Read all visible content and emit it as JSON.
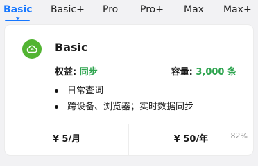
{
  "tabs": [
    {
      "label": "Basic",
      "active": true,
      "marker": "*"
    },
    {
      "label": "Basic+"
    },
    {
      "label": "Pro"
    },
    {
      "label": "Pro+"
    },
    {
      "label": "Max"
    },
    {
      "label": "Max+"
    }
  ],
  "plan": {
    "icon": "cloud-sync-icon",
    "name": "Basic",
    "rights_label": "权益:",
    "rights_value": "同步",
    "capacity_label": "容量:",
    "capacity_value": "3,000 条",
    "features": [
      "日常查词",
      "跨设备、浏览器；实时数据同步"
    ]
  },
  "pricing": {
    "monthly": "¥ 5/月",
    "yearly": "¥ 50/年",
    "yearly_discount": "82%"
  },
  "colors": {
    "accent": "#1677ff",
    "highlight_green": "#2ea44f",
    "icon_green": "#52b432"
  }
}
